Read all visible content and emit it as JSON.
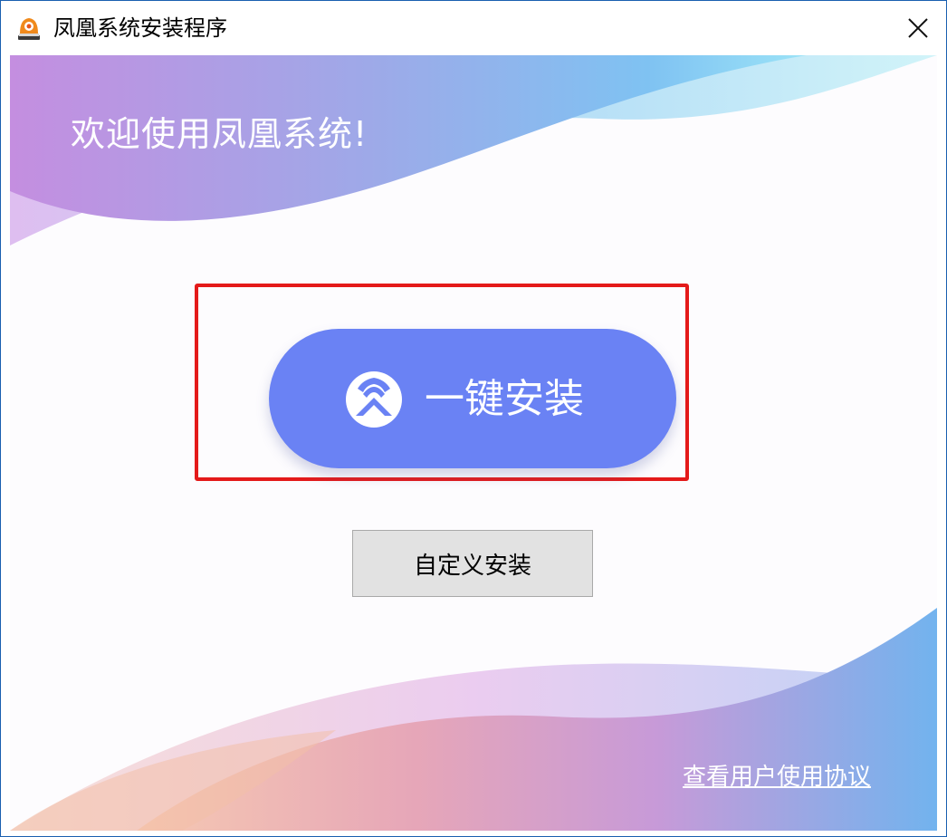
{
  "window": {
    "title": "凤凰系统安装程序"
  },
  "header": {
    "welcome_text": "欢迎使用凤凰系统!"
  },
  "actions": {
    "one_click_install_label": "一键安装",
    "custom_install_label": "自定义安装",
    "user_agreement_link": "查看用户使用协议"
  },
  "icons": {
    "app_icon": "phoenix-app-icon",
    "close_icon": "close-icon",
    "button_logo": "phoenix-logo-icon"
  },
  "colors": {
    "primary_button": "#6a82f4",
    "highlight_border": "#e41a1a",
    "secondary_button": "#e2e2e2"
  }
}
